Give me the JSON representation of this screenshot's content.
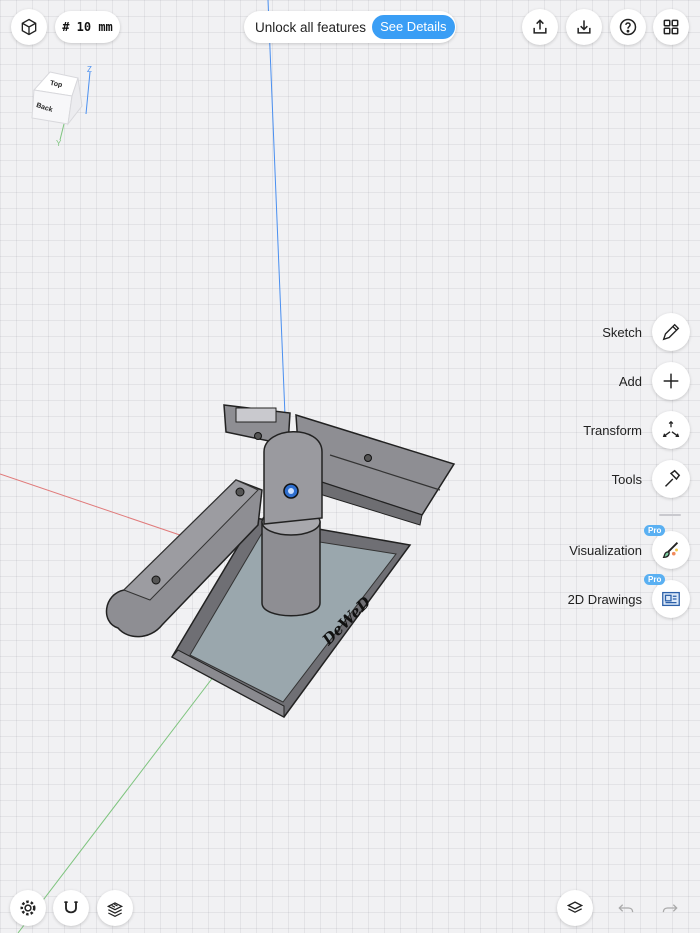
{
  "toolbar": {
    "grid_size": "# 10 mm",
    "unlock_text": "Unlock all features",
    "see_details": "See Details"
  },
  "view_cube": {
    "faces": [
      "Top",
      "Back"
    ],
    "axes": [
      "Z",
      "Y"
    ]
  },
  "side_menu": [
    {
      "label": "Sketch",
      "icon": "pencil-icon",
      "pro": false
    },
    {
      "label": "Add",
      "icon": "plus-icon",
      "pro": false
    },
    {
      "label": "Transform",
      "icon": "transform-icon",
      "pro": false
    },
    {
      "label": "Tools",
      "icon": "hammer-icon",
      "pro": false
    },
    {
      "label": "Visualization",
      "icon": "brush-icon",
      "pro": true
    },
    {
      "label": "2D Drawings",
      "icon": "drawing-sheet-icon",
      "pro": true
    }
  ],
  "pro_badge": "Pro",
  "model": {
    "engraving": "DeWeD"
  },
  "colors": {
    "accent": "#3a9ef5",
    "axis_x": "#e07a7a",
    "axis_y": "#7ec47e",
    "axis_z": "#4a8ff0",
    "model_gray": "#8e8e93",
    "base_top": "#9aa7ad"
  }
}
